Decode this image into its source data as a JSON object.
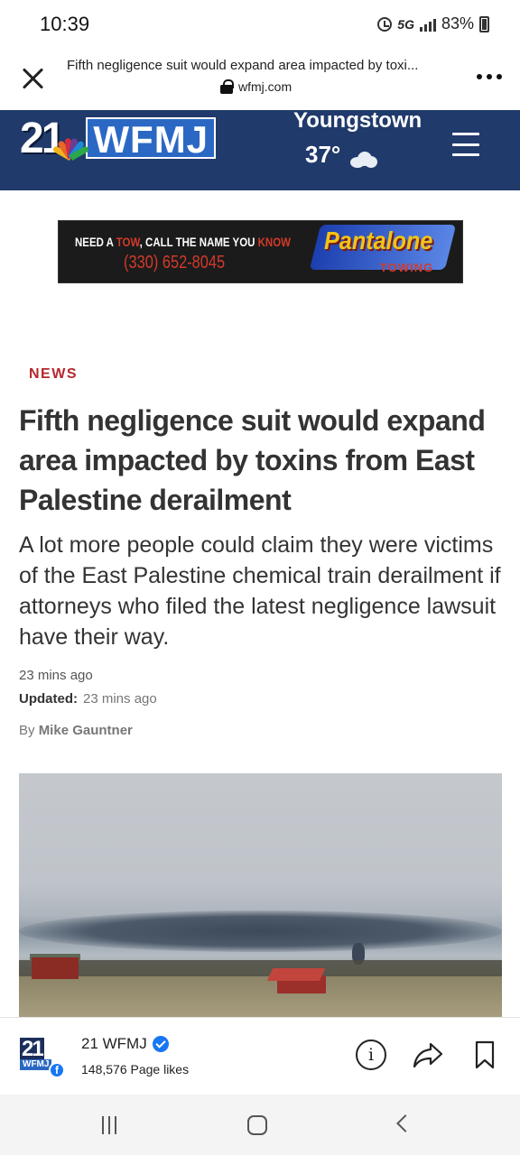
{
  "status_bar": {
    "time": "10:39",
    "network": "5G",
    "battery": "83%",
    "icons": [
      "alarm-icon",
      "signal-icon",
      "battery-icon"
    ]
  },
  "browser": {
    "page_title": "Fifth negligence suit would expand area impacted by toxi...",
    "url": "wfmj.com",
    "icons": [
      "close-icon",
      "lock-icon",
      "more-icon"
    ]
  },
  "site_header": {
    "logo_number": "21",
    "logo_text": "WFMJ",
    "weather_city": "Youngstown",
    "weather_temp": "37°",
    "weather_icon": "cloud-icon",
    "menu_icon": "hamburger-menu-icon",
    "colors": {
      "header_bg": "#203a6b",
      "logo_blue": "#2b68c4"
    }
  },
  "ad": {
    "line1_a": "NEED A ",
    "line1_b": "TOW",
    "line1_c": ", CALL THE NAME YOU ",
    "line1_d": "KNOW",
    "phone": "(330) 652-8045",
    "brand": "Pantalone",
    "sub": "TOWING"
  },
  "article": {
    "section": "NEWS",
    "headline": "Fifth negligence suit would expand area impacted by toxins from East Palestine derailment",
    "summary": "A lot more people could claim they were victims of the East Palestine chemical train derailment if attorneys who filed the latest negligence lawsuit have their way.",
    "time_ago": "23 mins ago",
    "updated_label": "Updated:",
    "updated_value": "23 mins ago",
    "byline_prefix": "By",
    "author": "Mike Gauntner",
    "colors": {
      "section": "#b3282d"
    }
  },
  "facebook_bar": {
    "page_name": "21 WFMJ",
    "likes": "148,576 Page likes",
    "avatar_number": "21",
    "avatar_text": "WFMJ",
    "badge": "f",
    "info_glyph": "i",
    "icons": [
      "verified-icon",
      "info-icon",
      "share-icon",
      "bookmark-icon"
    ]
  },
  "nav_bar": {
    "icons": [
      "recents-icon",
      "home-icon",
      "back-icon"
    ]
  }
}
